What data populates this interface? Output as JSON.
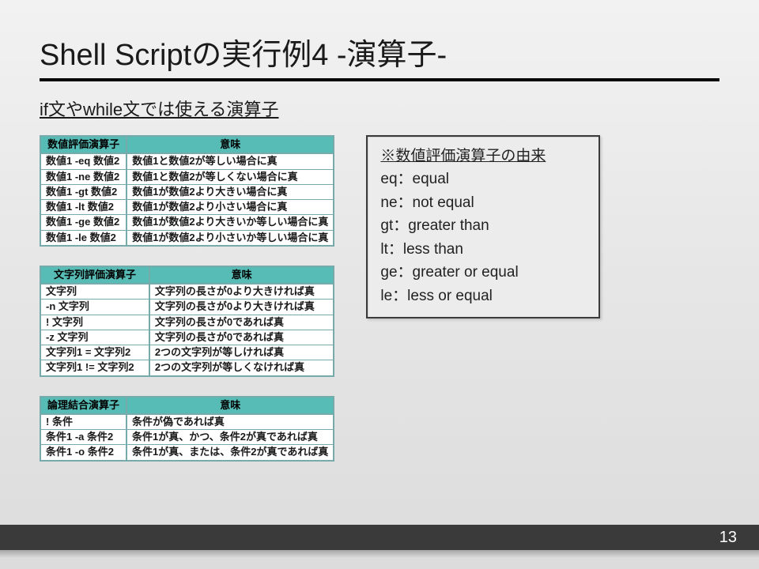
{
  "title": "Shell Scriptの実行例4 -演算子-",
  "subtitle": "if文やwhile文では使える演算子",
  "tables": {
    "numeric": {
      "headers": [
        "数値評価演算子",
        "意味"
      ],
      "rows": [
        [
          "数値1 -eq 数値2",
          "数値1と数値2が等しい場合に真"
        ],
        [
          "数値1 -ne 数値2",
          "数値1と数値2が等しくない場合に真"
        ],
        [
          "数値1 -gt 数値2",
          "数値1が数値2より大きい場合に真"
        ],
        [
          "数値1 -lt 数値2",
          "数値1が数値2より小さい場合に真"
        ],
        [
          "数値1 -ge 数値2",
          "数値1が数値2より大きいか等しい場合に真"
        ],
        [
          "数値1 -le 数値2",
          "数値1が数値2より小さいか等しい場合に真"
        ]
      ]
    },
    "string": {
      "headers": [
        "文字列評価演算子",
        "意味"
      ],
      "rows": [
        [
          "文字列",
          "文字列の長さが0より大きければ真"
        ],
        [
          "-n 文字列",
          "文字列の長さが0より大きければ真"
        ],
        [
          "! 文字列",
          "文字列の長さが0であれば真"
        ],
        [
          "-z 文字列",
          "文字列の長さが0であれば真"
        ],
        [
          "文字列1 = 文字列2",
          "2つの文字列が等しければ真"
        ],
        [
          "文字列1 != 文字列2",
          "2つの文字列が等しくなければ真"
        ]
      ]
    },
    "logical": {
      "headers": [
        "論理結合演算子",
        "意味"
      ],
      "rows": [
        [
          "! 条件",
          "条件が偽であれば真"
        ],
        [
          "条件1 -a 条件2",
          "条件1が真、かつ、条件2が真であれば真"
        ],
        [
          "条件1 -o 条件2",
          "条件1が真、または、条件2が真であれば真"
        ]
      ]
    }
  },
  "note": {
    "title": "※数値評価演算子の由来",
    "lines": [
      "eq：equal",
      "ne：not equal",
      "gt：greater than",
      "lt：less than",
      "ge：greater or equal",
      "le：less or equal"
    ]
  },
  "page_number": "13"
}
